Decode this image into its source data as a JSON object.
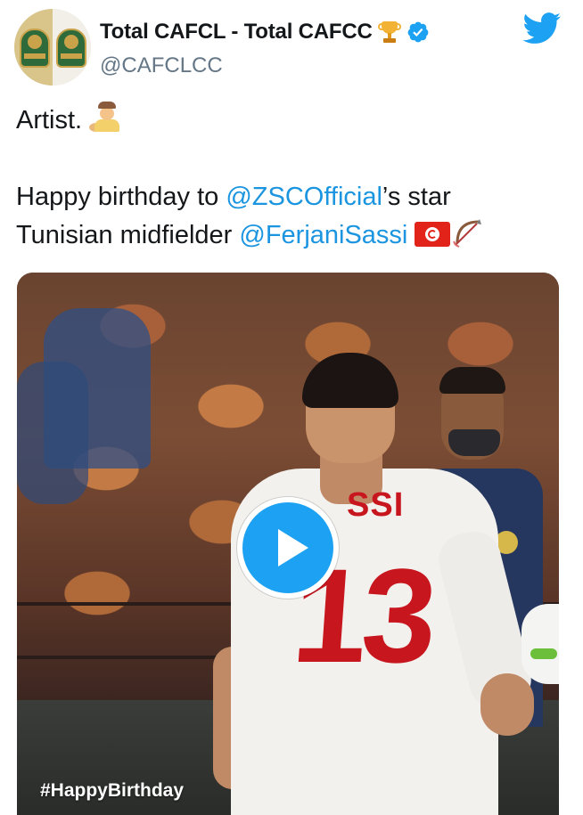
{
  "account": {
    "display_name": "Total CAFCL - Total CAFCC",
    "handle": "@CAFCLCC",
    "name_emoji": "trophy-icon",
    "verified": true
  },
  "brand": {
    "icon": "twitter-icon",
    "color": "#1da1f2"
  },
  "tweet": {
    "line1": "Artist.",
    "line1_emoji": "artist-icon",
    "line2_prefix": "Happy birthday to ",
    "line2_mention": "@ZSCOfficial",
    "line2_suffix": "’s star",
    "line3_prefix": "Tunisian midfielder ",
    "line3_mention": "@FerjaniSassi",
    "line3_emojis": [
      "tunisia-flag-icon",
      "bow-and-arrow-icon"
    ]
  },
  "media": {
    "type": "video",
    "hashtag": "#HappyBirthday",
    "jersey_name": "SSI",
    "jersey_number": "13",
    "play_icon": "play-icon"
  },
  "colors": {
    "mention": "#1b95e0",
    "text": "#14171a",
    "secondary": "#657786",
    "verified": "#1da1f2",
    "jersey_red": "#c8161e"
  }
}
